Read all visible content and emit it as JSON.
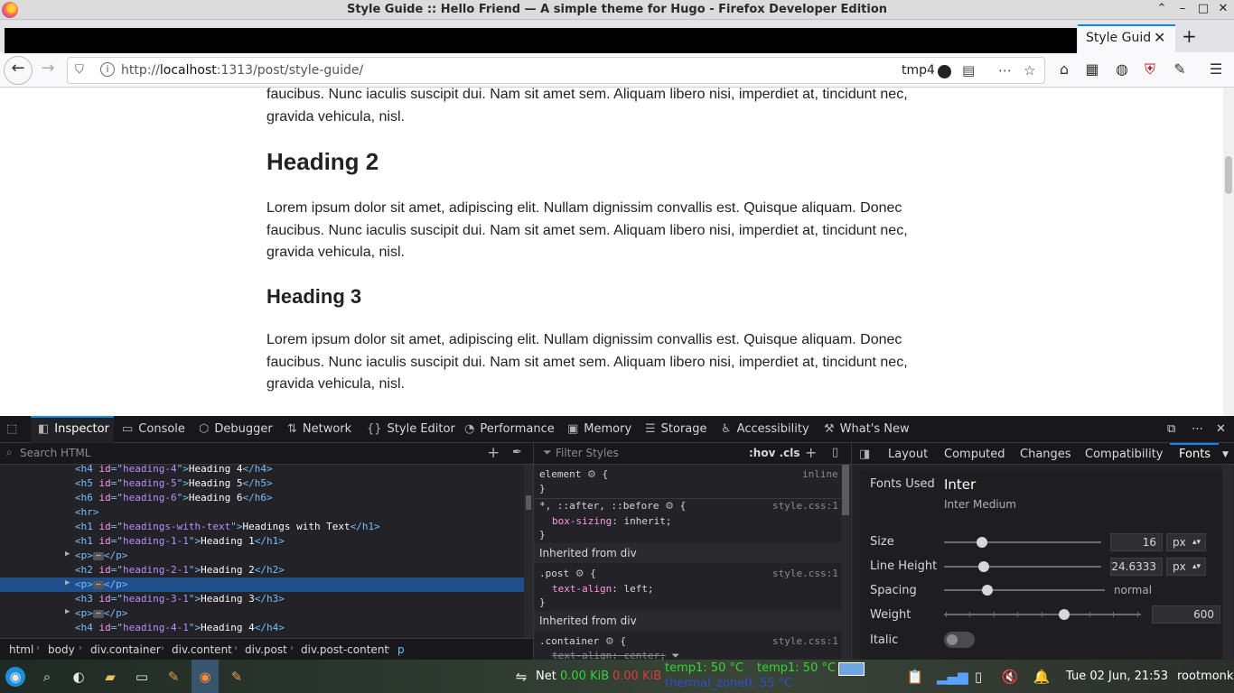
{
  "window": {
    "title": "Style Guide :: Hello Friend — A simple theme for Hugo - Firefox Developer Edition"
  },
  "tabs": {
    "active_label": "Style Guide",
    "close_glyph": "✕",
    "new_tab_glyph": "+"
  },
  "nav": {
    "url_prefix": "http://",
    "url_host": "localhost",
    "url_rest": ":1313/post/style-guide/",
    "extension_label": "tmp4"
  },
  "page": {
    "para_top": "faucibus. Nunc iaculis suscipit dui. Nam sit amet sem. Aliquam libero nisi, imperdiet at, tincidunt nec, gravida vehicula, nisl.",
    "heading2": "Heading 2",
    "para_1": "Lorem ipsum dolor sit amet, adipiscing elit. Nullam dignissim convallis est. Quisque aliquam. Donec faucibus. Nunc iaculis suscipit dui. Nam sit amet sem. Aliquam libero nisi, imperdiet at, tincidunt nec, gravida vehicula, nisl.",
    "heading3": "Heading 3",
    "para_2": "Lorem ipsum dolor sit amet, adipiscing elit. Nullam dignissim convallis est. Quisque aliquam. Donec faucibus. Nunc iaculis suscipit dui. Nam sit amet sem. Aliquam libero nisi, imperdiet at, tincidunt nec, gravida vehicula, nisl."
  },
  "devtools": {
    "tabs": [
      "Inspector",
      "Console",
      "Debugger",
      "Network",
      "Style Editor",
      "Performance",
      "Memory",
      "Storage",
      "Accessibility",
      "What's New"
    ],
    "search_placeholder": "Search HTML",
    "markup": [
      {
        "tag": "h4",
        "id": "heading-4",
        "text": "Heading 4"
      },
      {
        "tag": "h5",
        "id": "heading-5",
        "text": "Heading 5"
      },
      {
        "tag": "h6",
        "id": "heading-6",
        "text": "Heading 6"
      },
      {
        "tag": "hr"
      },
      {
        "tag": "h1",
        "id": "headings-with-text",
        "text": "Headings with Text"
      },
      {
        "tag": "h1",
        "id": "heading-1-1",
        "text": "Heading 1"
      },
      {
        "tag": "p",
        "collapsed": true
      },
      {
        "tag": "h2",
        "id": "heading-2-1",
        "text": "Heading 2"
      },
      {
        "tag": "p",
        "collapsed": true,
        "selected": true
      },
      {
        "tag": "h3",
        "id": "heading-3-1",
        "text": "Heading 3"
      },
      {
        "tag": "p",
        "collapsed": true
      },
      {
        "tag": "h4",
        "id": "heading-4-1",
        "text": "Heading 4"
      }
    ],
    "breadcrumbs": [
      "html",
      "body",
      "div.container",
      "div.content",
      "div.post",
      "div.post-content",
      "p"
    ],
    "rules": {
      "filter_placeholder": "Filter Styles",
      "hov_cls": ":hov .cls",
      "element_selector": "element",
      "element_source": "inline",
      "universal_selector": "*, ::after, ::before",
      "universal_source": "style.css:1",
      "universal_prop": "box-sizing",
      "universal_val": "inherit",
      "inherited_1": "Inherited from div",
      "post_selector": ".post",
      "post_source": "style.css:1",
      "post_prop": "text-align",
      "post_val": "left",
      "inherited_2": "Inherited from div",
      "container_selector": ".container",
      "container_source": "style.css:1",
      "container_prop": "text-align",
      "container_val": "center"
    },
    "sidebar_tabs": [
      "Layout",
      "Computed",
      "Changes",
      "Compatibility",
      "Fonts"
    ],
    "fonts": {
      "fonts_used_label": "Fonts Used",
      "family": "Inter",
      "face": "Inter Medium",
      "size_label": "Size",
      "size_value": "16",
      "size_unit": "px",
      "size_fraction": 0.24,
      "line_height_label": "Line Height",
      "line_height_value": "24.6333",
      "line_height_unit": "px",
      "line_height_fraction": 0.25,
      "spacing_label": "Spacing",
      "spacing_value": "normal",
      "spacing_fraction": 0.27,
      "weight_label": "Weight",
      "weight_value": "600",
      "weight_fraction": 0.61,
      "italic_label": "Italic"
    }
  },
  "taskbar": {
    "net_label": "Net",
    "net_down": "0.00 KiB",
    "net_up": "0.00 KiB",
    "temp1": "temp1: 50 °C",
    "temp2": "temp1: 50 °C",
    "thermal": "thermal_zone0: 55 °C",
    "clock": "Tue 02 Jun, 21:53",
    "user": "rootmonk"
  },
  "colors": {
    "accent": "#0a84ff",
    "selected_row": "#204e8a"
  }
}
